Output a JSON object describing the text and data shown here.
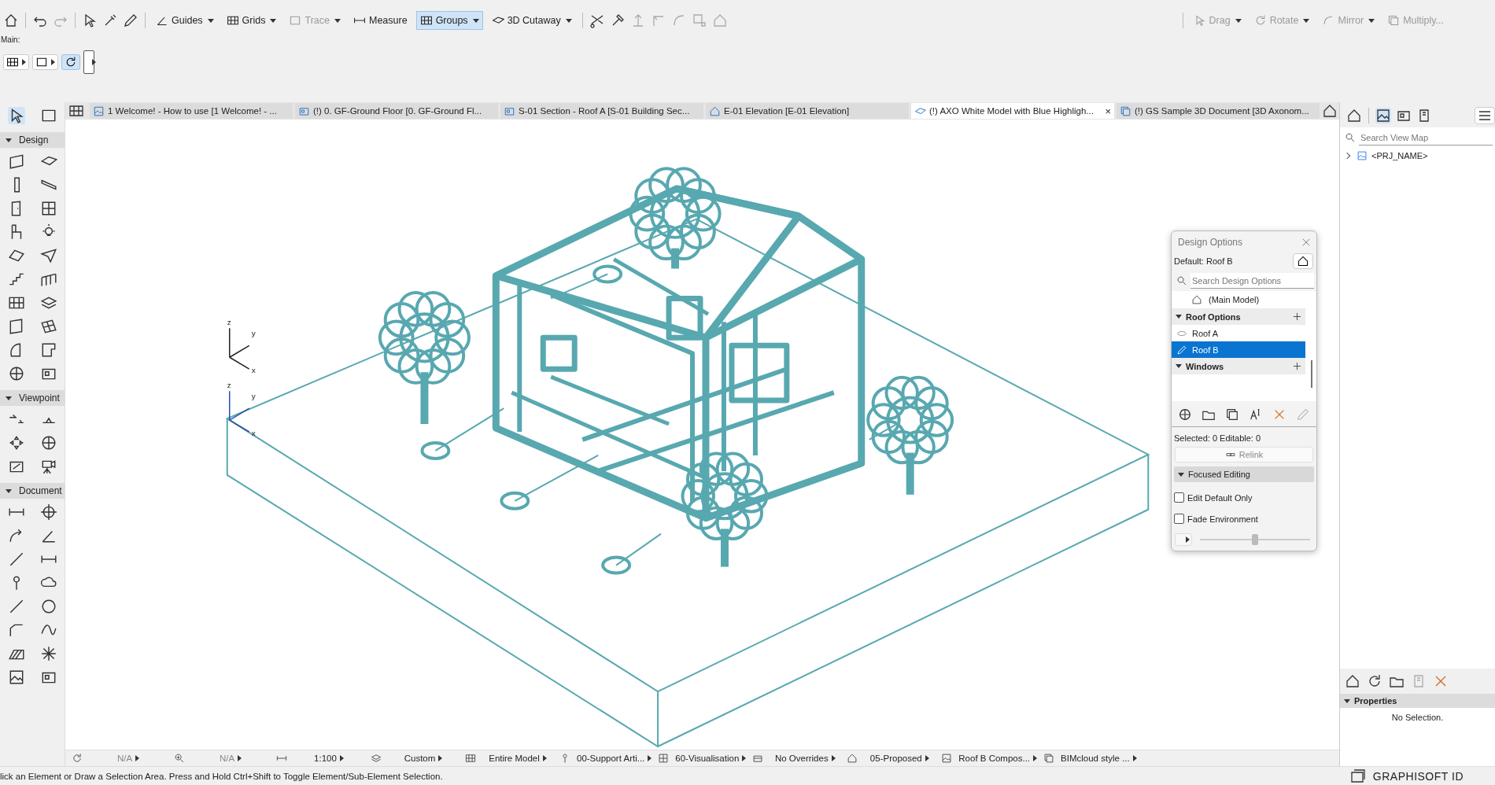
{
  "toolbar": {
    "left_tools": [
      {
        "label": "Guides",
        "disabled": false,
        "selected": false,
        "dropdown": true
      },
      {
        "label": "Grids",
        "disabled": false,
        "selected": false,
        "dropdown": true
      },
      {
        "label": "Trace",
        "disabled": true,
        "selected": false,
        "dropdown": true
      },
      {
        "label": "Measure",
        "disabled": false,
        "selected": false,
        "dropdown": false
      },
      {
        "label": "Groups",
        "disabled": false,
        "selected": true,
        "dropdown": true
      },
      {
        "label": "3D Cutaway",
        "disabled": false,
        "selected": false,
        "dropdown": true
      }
    ],
    "right_tools": [
      {
        "label": "Drag",
        "disabled": true,
        "dropdown": true
      },
      {
        "label": "Rotate",
        "disabled": true,
        "dropdown": true
      },
      {
        "label": "Mirror",
        "disabled": true,
        "dropdown": true
      },
      {
        "label": "Multiply...",
        "disabled": true,
        "dropdown": false
      }
    ],
    "main_label": "Main:"
  },
  "tabs": {
    "close_glyph": "×",
    "items": [
      {
        "label": "1 Welcome! - How to use [1 Welcome! - ...",
        "selected": false
      },
      {
        "label": "(!) 0. GF-Ground Floor [0. GF-Ground Fl...",
        "selected": false
      },
      {
        "label": "S-01 Section - Roof A [S-01 Building Sec...",
        "selected": false
      },
      {
        "label": "E-01 Elevation [E-01 Elevation]",
        "selected": false
      },
      {
        "label": "(!) AXO White Model with Blue Highligh...",
        "selected": true
      },
      {
        "label": "(!) GS Sample 3D Document [3D Axonom...",
        "selected": false
      }
    ]
  },
  "toolbox": {
    "sections": [
      {
        "title": "Design",
        "expanded": true
      },
      {
        "title": "Viewpoint",
        "expanded": true
      },
      {
        "title": "Document",
        "expanded": true
      }
    ]
  },
  "viewport": {
    "axes": [
      {
        "z": "z",
        "y": "y",
        "x": "x"
      },
      {
        "z": "z",
        "y": "y",
        "x": "x"
      }
    ]
  },
  "design_options": {
    "title": "Design Options",
    "default_label": "Default: Roof B",
    "search_placeholder": "Search Design Options",
    "main_model": "(Main Model)",
    "groups": [
      {
        "name": "Roof Options",
        "expanded": true,
        "options": [
          {
            "name": "Roof A",
            "kind": "preview",
            "selected": false
          },
          {
            "name": "Roof B",
            "kind": "editing",
            "selected": true
          }
        ]
      },
      {
        "name": "Windows",
        "expanded": true
      }
    ],
    "counts": "Selected: 0 Editable: 0",
    "relink": {
      "label": "Relink",
      "disabled": true
    },
    "focused_editing": {
      "title": "Focused Editing",
      "expanded": true
    },
    "checkboxes": [
      {
        "label": "Edit Default Only",
        "checked": false
      },
      {
        "label": "Fade Environment",
        "checked": false
      }
    ],
    "slider": {
      "level": 0.5
    }
  },
  "navigator": {
    "search_placeholder": "Search View Map",
    "tree": [
      {
        "label": "<PRJ_NAME>",
        "expanded": false
      }
    ],
    "properties_title": "Properties",
    "properties_text": "No Selection."
  },
  "status_bar": {
    "items": [
      "N/A",
      "N/A",
      "1:100",
      "Custom",
      "Entire Model",
      "00-Support Arti...",
      "60-Visualisation",
      "No Overrides",
      "05-Proposed",
      "Roof B Compos...",
      "BIMcloud style ..."
    ],
    "message": "lick an Element or Draw a Selection Area. Press and Hold Ctrl+Shift to Toggle Element/Sub-Element Selection.",
    "brand": "GRAPHISOFT ID"
  }
}
